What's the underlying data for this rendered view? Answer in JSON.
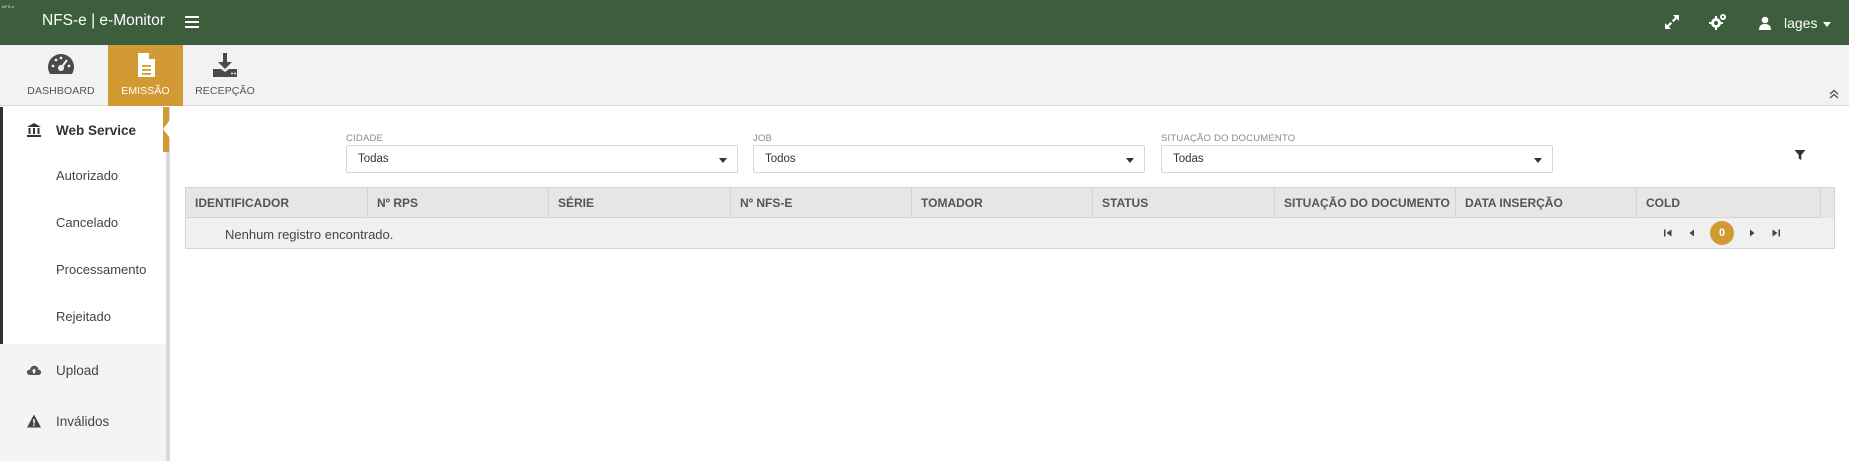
{
  "header": {
    "logo_text": "NFS-e",
    "app_title": "NFS-e | e-Monitor",
    "user_name": "lages",
    "icons": [
      "menu-icon",
      "fullscreen-icon",
      "settings-cogs-icon",
      "user-icon"
    ]
  },
  "modules": [
    {
      "label": "DASHBOARD",
      "icon": "dashboard-gauge-icon",
      "active": false
    },
    {
      "label": "EMISSÃO",
      "icon": "document-icon",
      "active": true
    },
    {
      "label": "RECEPÇÃO",
      "icon": "download-tray-icon",
      "active": false
    }
  ],
  "sidebar": {
    "main_item": {
      "label": "Web Service",
      "icon": "bank-icon"
    },
    "sub_items": [
      "Autorizado",
      "Cancelado",
      "Processamento",
      "Rejeitado"
    ],
    "items": [
      {
        "label": "Upload",
        "icon": "cloud-upload-icon"
      },
      {
        "label": "Inválidos",
        "icon": "warning-icon"
      }
    ]
  },
  "filters": [
    {
      "label": "CIDADE",
      "value": "Todas"
    },
    {
      "label": "JOB",
      "value": "Todos"
    },
    {
      "label": "SITUAÇÃO DO DOCUMENTO",
      "value": "Todas"
    }
  ],
  "table": {
    "columns": [
      "IDENTIFICADOR",
      "Nº RPS",
      "SÉRIE",
      "Nº NFS-E",
      "TOMADOR",
      "STATUS",
      "SITUAÇÃO DO DOCUMENTO",
      "DATA INSERÇÃO",
      "COLD"
    ],
    "empty_message": "Nenhum registro encontrado.",
    "current_page": "0"
  },
  "colors": {
    "header_bg": "#3c5e3c",
    "accent": "#d29a33",
    "toolbar_bg": "#f2f2f2"
  }
}
